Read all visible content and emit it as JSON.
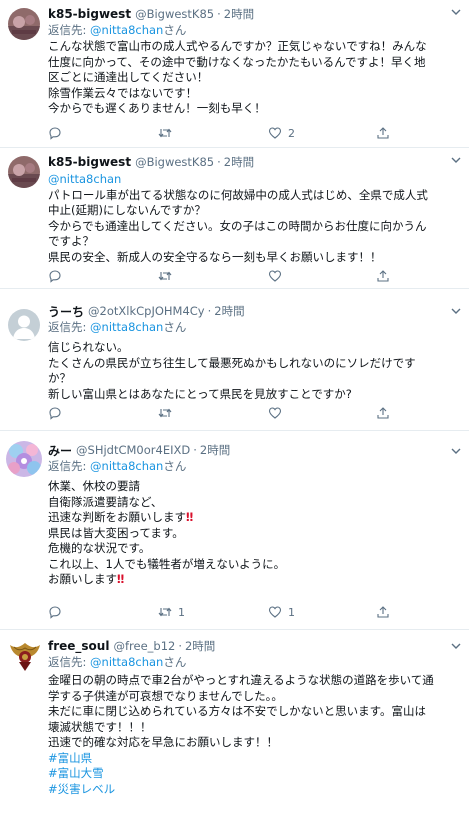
{
  "tweets": [
    {
      "name": "k85-bigwest",
      "handle": "@BigwestK85",
      "dot": "·",
      "time": "2時間",
      "reply_prefix": "返信先: ",
      "reply_mention": "@nitta8chan",
      "reply_suffix": "さん",
      "lines": [
        "こんな状態で富山市の成人式やるんですか？正気じゃないですね！みんな",
        "仕度に向かって、その途中で動けなくなったかたもいるんですよ！早く地",
        "区ごとに通達出してください！",
        "除雪作業云々ではないです！",
        "今からでも遅くありません！一刻も早く！"
      ],
      "like_count": "2"
    },
    {
      "name": "k85-bigwest",
      "handle": "@BigwestK85",
      "dot": "·",
      "time": "2時間",
      "mention": "@nitta8chan",
      "lines": [
        "パトロール車が出てる状態なのに何故婦中の成人式はじめ、全県で成人式",
        "中止(延期)にしないんですか？",
        "今からでも通達出してください。女の子はこの時間からお仕度に向かうん",
        "ですよ？",
        "県民の安全、新成人の安全守るなら一刻も早くお願いします！！"
      ]
    },
    {
      "name": "うーち",
      "handle": "@2otXlkCpJOHM4Cy",
      "dot": "·",
      "time": "2時間",
      "reply_prefix": "返信先: ",
      "reply_mention": "@nitta8chan",
      "reply_suffix": "さん",
      "lines": [
        "信じられない。",
        "たくさんの県民が立ち往生して最悪死ぬかもしれないのにソレだけです",
        "か？",
        "新しい富山県とはあなたにとって県民を見放すことですか?"
      ]
    },
    {
      "name": "みー",
      "handle": "@SHjdtCM0or4EIXD",
      "dot": "·",
      "time": "2時間",
      "reply_prefix": "返信先: ",
      "reply_mention": "@nitta8chan",
      "reply_suffix": "さん",
      "lines": [
        "休業、休校の要請",
        "自衛隊派遣要請など、",
        "迅速な判断をお願いします",
        "",
        "県民は皆大変困ってます。",
        "危機的な状況です。",
        "これ以上、1人でも犠牲者が増えないように。",
        "お願いします"
      ],
      "emoji": "‼",
      "retweet_count": "1",
      "like_count": "1"
    },
    {
      "name": "free_soul",
      "handle": "@free_b12",
      "dot": "·",
      "time": "2時間",
      "reply_prefix": "返信先: ",
      "reply_mention": "@nitta8chan",
      "reply_suffix": "さん",
      "lines": [
        "金曜日の朝の時点で車2台がやっとすれ違えるような状態の道路を歩いて通",
        "学する子供達が可哀想でなりませんでした。。",
        "未だに車に閉じ込められている方々は不安でしかないと思います。富山は",
        "壊滅状態です！！！",
        "迅速で的確な対応を早急にお願いします！！"
      ],
      "hashtags": [
        "#富山県",
        "#富山大雪",
        "#災害レベル"
      ]
    }
  ],
  "colors": {
    "text": "#0f1419",
    "muted": "#5b7083",
    "link": "#1b95e0",
    "border": "#e6ecf0",
    "emoji_red": "#d9102c"
  }
}
